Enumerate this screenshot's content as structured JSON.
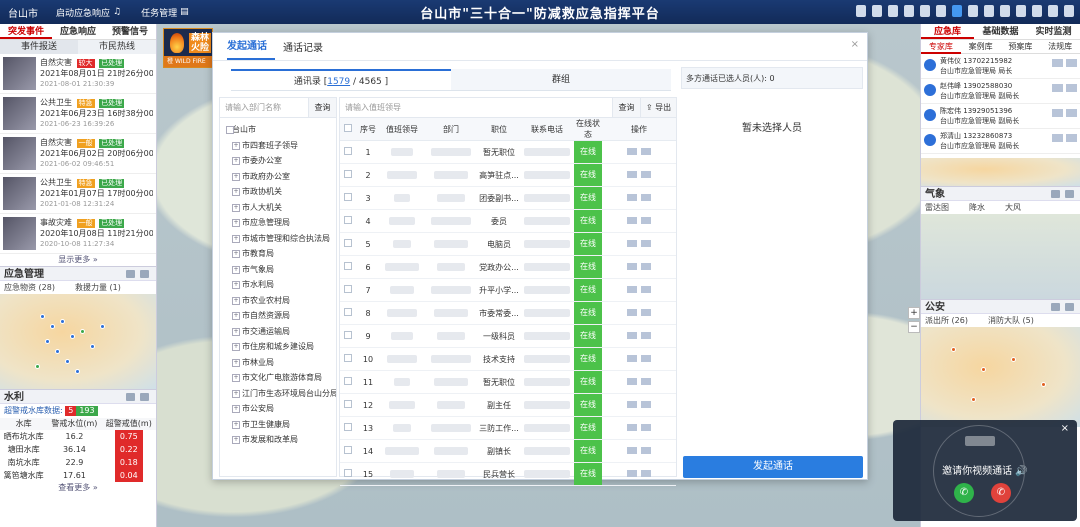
{
  "topbar": {
    "city": "台山市",
    "nav": [
      "启动应急响应",
      "任务管理"
    ],
    "title": "台山市\"三十合一\"防减救应急指挥平台"
  },
  "fire_badge": {
    "text": "森林火险",
    "level": "橙",
    "en": "WILD FIRE"
  },
  "left": {
    "tabs": [
      "突发事件",
      "应急响应",
      "预警信号"
    ],
    "subtabs": [
      "事件报送",
      "市民热线"
    ],
    "events": [
      {
        "type": "自然灾害",
        "badge": "较大",
        "badge_color": "#e02a2a",
        "status": "已处理",
        "date": "2021年08月01日 21时26分00",
        "ts": "2021-08-01 21:30:39"
      },
      {
        "type": "公共卫生",
        "badge": "特急",
        "badge_color": "#f0a020",
        "status": "已处理",
        "date": "2021年06月23日 16时38分00",
        "ts": "2021-06-23 16:39:26"
      },
      {
        "type": "自然灾害",
        "badge": "一般",
        "badge_color": "#f0a020",
        "status": "已处理",
        "date": "2021年06月02日 20时06分00",
        "ts": "2021-06-02 09:46:51"
      },
      {
        "type": "公共卫生",
        "badge": "特急",
        "badge_color": "#f0a020",
        "status": "已处理",
        "date": "2021年01月07日 17时00分00",
        "ts": "2021-01-08 12:31:24"
      },
      {
        "type": "事故灾难",
        "badge": "一般",
        "badge_color": "#f0a020",
        "status": "已处理",
        "date": "2020年10月08日 11时21分00",
        "ts": "2020-10-08 11:27:34"
      }
    ],
    "show_more": "显示更多 »",
    "mgmt_title": "应急管理",
    "mgmt_sub": [
      "应急物资 (28)",
      "救援力量 (1)"
    ],
    "water_title": "水利",
    "water_alert_label": "超警戒水库数据:",
    "water_alert_red": "5",
    "water_alert_green": "193",
    "water_cols": [
      "水库",
      "警戒水位(m)",
      "超警戒值(m)"
    ],
    "water_rows": [
      [
        "晒布坑水库",
        "16.2",
        "0.75"
      ],
      [
        "塘田水库",
        "36.14",
        "0.22"
      ],
      [
        "南坑水库",
        "22.9",
        "0.18"
      ],
      [
        "篱笆塘水库",
        "17.61",
        "0.04"
      ]
    ],
    "water_more": "查看更多 »"
  },
  "right": {
    "tabs": [
      "应急库",
      "基础数据",
      "实时监测"
    ],
    "subtabs": [
      "专家库",
      "案例库",
      "预案库",
      "法规库"
    ],
    "contacts": [
      {
        "name": "黄伟仪",
        "phone": "13702215982",
        "org": "台山市应急管理局 局长"
      },
      {
        "name": "赵伟峰",
        "phone": "13902588030",
        "org": "台山市应急管理局 副局长"
      },
      {
        "name": "陈宏伟",
        "phone": "13929051396",
        "org": "台山市应急管理局 副局长"
      },
      {
        "name": "郑清山",
        "phone": "13232860873",
        "org": "台山市应急管理局 副局长"
      }
    ],
    "weather_title": "气象",
    "weather_sub": [
      "雷达图",
      "降水",
      "大风"
    ],
    "police_title": "公安",
    "police_sub": [
      "派出所 (26)",
      "消防大队 (5)"
    ]
  },
  "modal": {
    "tabs": [
      "发起通话",
      "通话记录"
    ],
    "close": "×",
    "addr_label": "通讯录 [",
    "addr_selected": "1579",
    "addr_total": " / 4565 ]",
    "group_label": "群组",
    "dept_placeholder": "请输入部门名称",
    "search_btn": "查询",
    "name_placeholder": "请输入值班领导",
    "export_btn": "导出",
    "tree_root": "台山市",
    "tree": [
      "市四套班子领导",
      "市委办公室",
      "市政府办公室",
      "市政协机关",
      "市人大机关",
      "市应急管理局",
      "市城市管理和综合执法局",
      "市教育局",
      "市气象局",
      "市水利局",
      "市农业农村局",
      "市自然资源局",
      "市交通运输局",
      "市住房和城乡建设局",
      "市林业局",
      "市文化广电旅游体育局",
      "江门市生态环境局台山分局",
      "市公安局",
      "市卫生健康局",
      "市发展和改革局"
    ],
    "cols": [
      "序号",
      "值班领导",
      "部门",
      "职位",
      "联系电话",
      "在线状态",
      "操作"
    ],
    "rows": [
      {
        "no": "1",
        "pos": "暂无职位",
        "status": "在线"
      },
      {
        "no": "2",
        "pos": "高笋驻点...",
        "status": "在线"
      },
      {
        "no": "3",
        "pos": "团委副书...",
        "status": "在线"
      },
      {
        "no": "4",
        "pos": "委员",
        "status": "在线"
      },
      {
        "no": "5",
        "pos": "电脑员",
        "status": "在线"
      },
      {
        "no": "6",
        "pos": "党政办公...",
        "status": "在线"
      },
      {
        "no": "7",
        "pos": "升平小学...",
        "status": "在线"
      },
      {
        "no": "8",
        "pos": "市委常委...",
        "status": "在线"
      },
      {
        "no": "9",
        "pos": "一级科员",
        "status": "在线"
      },
      {
        "no": "10",
        "pos": "技术支持",
        "status": "在线"
      },
      {
        "no": "11",
        "pos": "暂无职位",
        "status": "在线"
      },
      {
        "no": "12",
        "pos": "副主任",
        "status": "在线"
      },
      {
        "no": "13",
        "pos": "三防工作...",
        "status": "在线"
      },
      {
        "no": "14",
        "pos": "副镇长",
        "status": "在线"
      },
      {
        "no": "15",
        "pos": "民兵营长",
        "status": "在线"
      }
    ],
    "selected_label": "多方通话已选人员(人): ",
    "selected_count": "0",
    "empty_text": "暂未选择人员",
    "call_btn": "发起通话"
  },
  "invite": {
    "message": "邀请你视频通话",
    "close": "×"
  }
}
